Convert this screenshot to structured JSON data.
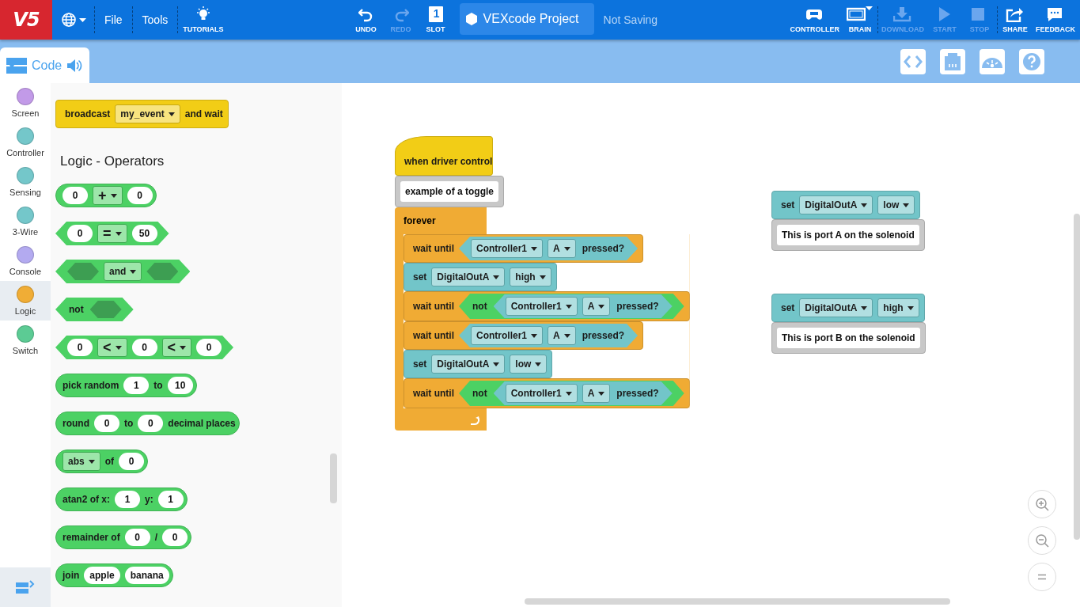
{
  "toolbar": {
    "logo": "V5",
    "menus": [
      "File",
      "Tools"
    ],
    "tutorials": "TUTORIALS",
    "center_buttons": [
      {
        "kind": "undo",
        "label": "UNDO",
        "disabled": false
      },
      {
        "kind": "redo",
        "label": "REDO",
        "disabled": true
      },
      {
        "kind": "slot",
        "label": "SLOT",
        "number": "1",
        "disabled": false
      }
    ],
    "project_name": "VEXcode Project",
    "save_status": "Not Saving",
    "right_buttons": [
      {
        "kind": "controller",
        "label": "CONTROLLER",
        "disabled": false
      },
      {
        "kind": "brain",
        "label": "BRAIN",
        "disabled": false
      },
      {
        "kind": "download",
        "label": "DOWNLOAD",
        "disabled": true
      },
      {
        "kind": "start",
        "label": "START",
        "disabled": true
      },
      {
        "kind": "stop",
        "label": "STOP",
        "disabled": true
      },
      {
        "kind": "share",
        "label": "SHARE",
        "disabled": false
      },
      {
        "kind": "feedback",
        "label": "FEEDBACK",
        "disabled": false
      }
    ]
  },
  "code_tab": {
    "label": "Code",
    "selected": true
  },
  "view_buttons": [
    {
      "kind": "code"
    },
    {
      "kind": "devices"
    },
    {
      "kind": "dashboard"
    },
    {
      "kind": "help"
    }
  ],
  "categories": [
    {
      "label": "Screen",
      "color": "#c29ae8",
      "selected": false
    },
    {
      "label": "Controller",
      "color": "#74c7ca",
      "selected": false
    },
    {
      "label": "Sensing",
      "color": "#74c7ca",
      "selected": false
    },
    {
      "label": "3-Wire",
      "color": "#74c7ca",
      "selected": false
    },
    {
      "label": "Console",
      "color": "#b3aaf0",
      "selected": false
    },
    {
      "label": "Logic",
      "color": "#f0ad36",
      "selected": true
    },
    {
      "label": "Switch",
      "color": "#5ccb94",
      "selected": false
    }
  ],
  "palette": [
    {
      "kind": "block",
      "block": {
        "kind": "stack",
        "color": "#f2cd16",
        "parts": [
          {
            "kind": "label",
            "text": "broadcast"
          },
          {
            "kind": "dropdown",
            "text": "my_event"
          },
          {
            "kind": "label",
            "text": "and wait"
          }
        ]
      }
    },
    {
      "kind": "heading",
      "text": "Logic - Operators"
    },
    {
      "kind": "block",
      "block": {
        "kind": "reporter",
        "color": "#4cd164",
        "parts": [
          {
            "kind": "number",
            "text": "0"
          },
          {
            "kind": "dropdown",
            "text": "+",
            "big": true
          },
          {
            "kind": "number",
            "text": "0"
          }
        ]
      }
    },
    {
      "kind": "block",
      "block": {
        "kind": "boolean",
        "color": "#4cd164",
        "parts": [
          {
            "kind": "number",
            "text": "0"
          },
          {
            "kind": "dropdown",
            "text": "=",
            "big": true
          },
          {
            "kind": "number",
            "text": "50"
          }
        ]
      }
    },
    {
      "kind": "block",
      "block": {
        "kind": "boolean",
        "color": "#4cd164",
        "parts": [
          {
            "kind": "hole"
          },
          {
            "kind": "dropdown",
            "text": "and"
          },
          {
            "kind": "hole"
          }
        ]
      }
    },
    {
      "kind": "block",
      "block": {
        "kind": "boolean",
        "color": "#4cd164",
        "parts": [
          {
            "kind": "label",
            "text": "not"
          },
          {
            "kind": "hole"
          }
        ]
      }
    },
    {
      "kind": "block",
      "block": {
        "kind": "boolean",
        "color": "#4cd164",
        "parts": [
          {
            "kind": "number",
            "text": "0"
          },
          {
            "kind": "dropdown",
            "text": "<",
            "big": true
          },
          {
            "kind": "number",
            "text": "0"
          },
          {
            "kind": "dropdown",
            "text": "<",
            "big": true
          },
          {
            "kind": "number",
            "text": "0"
          }
        ]
      }
    },
    {
      "kind": "block",
      "block": {
        "kind": "reporter",
        "color": "#4cd164",
        "parts": [
          {
            "kind": "label",
            "text": "pick random"
          },
          {
            "kind": "number",
            "text": "1"
          },
          {
            "kind": "label",
            "text": "to"
          },
          {
            "kind": "number",
            "text": "10"
          }
        ]
      }
    },
    {
      "kind": "block",
      "block": {
        "kind": "reporter",
        "color": "#4cd164",
        "parts": [
          {
            "kind": "label",
            "text": "round"
          },
          {
            "kind": "number",
            "text": "0"
          },
          {
            "kind": "label",
            "text": "to"
          },
          {
            "kind": "number",
            "text": "0"
          },
          {
            "kind": "label",
            "text": "decimal places"
          }
        ]
      }
    },
    {
      "kind": "block",
      "block": {
        "kind": "reporter",
        "color": "#4cd164",
        "parts": [
          {
            "kind": "dropdown",
            "text": "abs"
          },
          {
            "kind": "label",
            "text": "of"
          },
          {
            "kind": "number",
            "text": "0"
          }
        ]
      }
    },
    {
      "kind": "block",
      "block": {
        "kind": "reporter",
        "color": "#4cd164",
        "parts": [
          {
            "kind": "label",
            "text": "atan2 of x:"
          },
          {
            "kind": "number",
            "text": "1"
          },
          {
            "kind": "label",
            "text": "y:"
          },
          {
            "kind": "number",
            "text": "1"
          }
        ]
      }
    },
    {
      "kind": "block",
      "block": {
        "kind": "reporter",
        "color": "#4cd164",
        "parts": [
          {
            "kind": "label",
            "text": "remainder of"
          },
          {
            "kind": "number",
            "text": "0"
          },
          {
            "kind": "label",
            "text": "/"
          },
          {
            "kind": "number",
            "text": "0"
          }
        ]
      }
    },
    {
      "kind": "block",
      "block": {
        "kind": "reporter",
        "color": "#4cd164",
        "parts": [
          {
            "kind": "label",
            "text": "join"
          },
          {
            "kind": "number",
            "text": "apple"
          },
          {
            "kind": "number",
            "text": "banana"
          }
        ]
      }
    }
  ],
  "scripts": [
    {
      "blocks": [
        {
          "kind": "hat",
          "color": "#f2cd16",
          "parts": [
            {
              "kind": "label",
              "text": "when driver control"
            }
          ]
        },
        {
          "kind": "comment",
          "color": "#c8c8c8",
          "parts": [
            {
              "kind": "text_input",
              "text": "example of a toggle"
            }
          ]
        },
        {
          "kind": "c",
          "color": "#f0ab34",
          "parts": [
            {
              "kind": "label",
              "text": "forever"
            }
          ],
          "children": [
            {
              "kind": "stack",
              "color": "#f0ab34",
              "parts": [
                {
                  "kind": "label",
                  "text": "wait until"
                },
                {
                  "kind": "block",
                  "block": {
                    "kind": "boolean",
                    "color": "#72c5c9",
                    "parts": [
                      {
                        "kind": "dropdown",
                        "text": "Controller1"
                      },
                      {
                        "kind": "dropdown",
                        "text": "A"
                      },
                      {
                        "kind": "label",
                        "text": "pressed?"
                      }
                    ]
                  }
                }
              ]
            },
            {
              "kind": "stack",
              "color": "#72c5c9",
              "parts": [
                {
                  "kind": "label",
                  "text": "set"
                },
                {
                  "kind": "dropdown",
                  "text": "DigitalOutA"
                },
                {
                  "kind": "dropdown",
                  "text": "high"
                }
              ]
            },
            {
              "kind": "stack",
              "color": "#f0ab34",
              "parts": [
                {
                  "kind": "label",
                  "text": "wait until"
                },
                {
                  "kind": "block",
                  "block": {
                    "kind": "boolean",
                    "color": "#4cd164",
                    "parts": [
                      {
                        "kind": "label",
                        "text": "not"
                      },
                      {
                        "kind": "block",
                        "block": {
                          "kind": "boolean",
                          "color": "#72c5c9",
                          "parts": [
                            {
                              "kind": "dropdown",
                              "text": "Controller1"
                            },
                            {
                              "kind": "dropdown",
                              "text": "A"
                            },
                            {
                              "kind": "label",
                              "text": "pressed?"
                            }
                          ]
                        }
                      }
                    ]
                  }
                }
              ]
            },
            {
              "kind": "stack",
              "color": "#f0ab34",
              "parts": [
                {
                  "kind": "label",
                  "text": "wait until"
                },
                {
                  "kind": "block",
                  "block": {
                    "kind": "boolean",
                    "color": "#72c5c9",
                    "parts": [
                      {
                        "kind": "dropdown",
                        "text": "Controller1"
                      },
                      {
                        "kind": "dropdown",
                        "text": "A"
                      },
                      {
                        "kind": "label",
                        "text": "pressed?"
                      }
                    ]
                  }
                }
              ]
            },
            {
              "kind": "stack",
              "color": "#72c5c9",
              "parts": [
                {
                  "kind": "label",
                  "text": "set"
                },
                {
                  "kind": "dropdown",
                  "text": "DigitalOutA"
                },
                {
                  "kind": "dropdown",
                  "text": "low"
                }
              ]
            },
            {
              "kind": "stack",
              "color": "#f0ab34",
              "parts": [
                {
                  "kind": "label",
                  "text": "wait until"
                },
                {
                  "kind": "block",
                  "block": {
                    "kind": "boolean",
                    "color": "#4cd164",
                    "parts": [
                      {
                        "kind": "label",
                        "text": "not"
                      },
                      {
                        "kind": "block",
                        "block": {
                          "kind": "boolean",
                          "color": "#72c5c9",
                          "parts": [
                            {
                              "kind": "dropdown",
                              "text": "Controller1"
                            },
                            {
                              "kind": "dropdown",
                              "text": "A"
                            },
                            {
                              "kind": "label",
                              "text": "pressed?"
                            }
                          ]
                        }
                      }
                    ]
                  }
                }
              ]
            }
          ]
        }
      ]
    },
    {
      "blocks": [
        {
          "kind": "stack",
          "color": "#72c5c9",
          "parts": [
            {
              "kind": "label",
              "text": "set"
            },
            {
              "kind": "dropdown",
              "text": "DigitalOutA"
            },
            {
              "kind": "dropdown",
              "text": "low"
            }
          ]
        },
        {
          "kind": "comment",
          "color": "#c8c8c8",
          "parts": [
            {
              "kind": "text_input",
              "text": "This is port A on the solenoid"
            }
          ]
        }
      ]
    },
    {
      "blocks": [
        {
          "kind": "stack",
          "color": "#72c5c9",
          "parts": [
            {
              "kind": "label",
              "text": "set"
            },
            {
              "kind": "dropdown",
              "text": "DigitalOutA"
            },
            {
              "kind": "dropdown",
              "text": "high"
            }
          ]
        },
        {
          "kind": "comment",
          "color": "#c8c8c8",
          "parts": [
            {
              "kind": "text_input",
              "text": "This is port B on the solenoid"
            }
          ]
        }
      ]
    }
  ],
  "zoom_buttons": [
    {
      "kind": "zoom_in"
    },
    {
      "kind": "zoom_out"
    },
    {
      "kind": "reset"
    }
  ]
}
